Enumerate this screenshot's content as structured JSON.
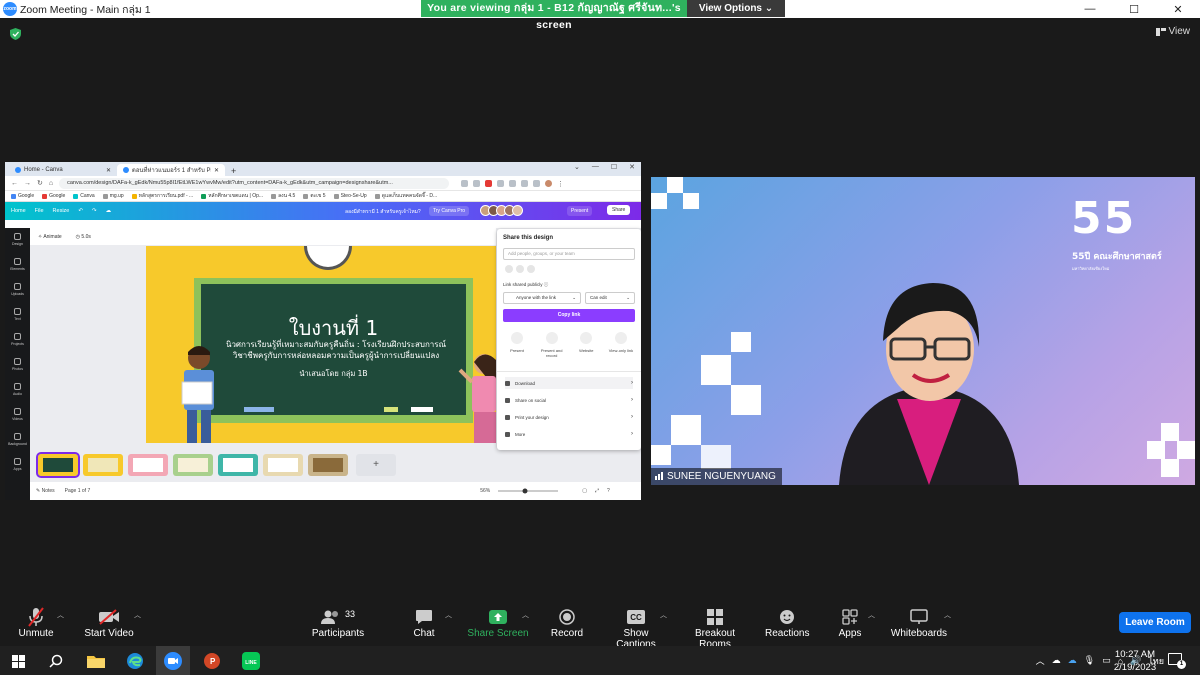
{
  "window": {
    "title": "Zoom Meeting - Main กลุ่ม 1",
    "logo_text": "zoom",
    "controls": [
      "—",
      "☐",
      "✕"
    ]
  },
  "banner": {
    "viewing_text": "You are viewing กลุ่ม 1 - B12 กัญญาณัฐ ศรีจันท...'s screen",
    "view_options": "View Options"
  },
  "view_button": "View",
  "shared_screen": {
    "tabs": [
      {
        "label": "Home - Canva"
      },
      {
        "label": "ตอนที่ห่าวแนมอร์ร 1 สำหรับ Pillow! - Freep..."
      }
    ],
    "url": "canva.com/design/DAFa-k_gEdk/Nmu55p8I1fEtLWE1wYwvMw/edit?utm_content=DAFa-k_gEdk&utm_campaign=designshare&utm...",
    "bookmarks": [
      "Google",
      "Google",
      "Canva",
      "mg.up",
      "หลักสูตรการเรียน.pdf - ...",
      "หลักศึกษาเขตแดน | Op...",
      "ลงน 4.5",
      "ตะเข 5",
      "Steo-Se-Up",
      "ดูแลเก็บแทคคนจัดจี๊ - D..."
    ],
    "canva": {
      "home": "Home",
      "file": "File",
      "resize": "Resize",
      "doc_title": "ลองมีสำหรามี 1 สำหรับครูเจ้าไหม?",
      "try_pro": "Try Canva Pro",
      "present": "Present",
      "share": "Share",
      "animate": "Animate",
      "duration": "5.0s",
      "sidebar": [
        "Design",
        "Elements",
        "Uploads",
        "Text",
        "Projects",
        "Photos",
        "Audio",
        "Videos",
        "Background",
        "Apps"
      ],
      "notes": "Notes",
      "page": "Page 1 of 7",
      "zoom": "56%",
      "slide": {
        "title": "ใบงานที่ 1",
        "subtitle_line1": "นิวศการเรียนรู้ที่เหมาะสมกับครูคืนถิ่น : โรงเรียนฝึกประสบการณ์",
        "subtitle_line2": "วิชาชีพครูกับการหล่อหลอมความเป็นครูผู้นำการเปลี่ยนแปลง",
        "presented_by": "นำเสนอโดย กลุ่ม 1B"
      },
      "share_panel": {
        "title": "Share this design",
        "input_placeholder": "Add people, groups, or your team",
        "link_label": "Link shared publicly ⓘ",
        "access": "Anyone with the link",
        "permission": "Can edit",
        "copy_link": "Copy link",
        "options": [
          {
            "label": "Present",
            "sub": ""
          },
          {
            "label": "Present and",
            "sub": "record"
          },
          {
            "label": "Website",
            "sub": ""
          },
          {
            "label": "View-only link",
            "sub": ""
          }
        ],
        "rows": [
          "Download",
          "Share on social",
          "Print your design",
          "More"
        ]
      }
    }
  },
  "video": {
    "participant_name": "SUNEE NGUENYUANG",
    "logo_text": "55",
    "logo_number": "55",
    "logo_sub": "ปี คณะศึกษาศาสตร์",
    "logo_sub_small": "มหาวิทยาลัยเชียงใหม่"
  },
  "toolbar": {
    "unmute": "Unmute",
    "start_video": "Start Video",
    "participants": "Participants",
    "participants_count": "33",
    "chat": "Chat",
    "share_screen": "Share Screen",
    "record": "Record",
    "show_captions": "Show Captions",
    "breakout_rooms": "Breakout Rooms",
    "reactions": "Reactions",
    "apps": "Apps",
    "whiteboards": "Whiteboards",
    "leave_room": "Leave Room"
  },
  "taskbar": {
    "language": "ไทย",
    "time": "10:27 AM",
    "date": "2/19/2023",
    "notification_count": "1"
  },
  "colors": {
    "share_green": "#2fb15e",
    "leave_blue": "#0e72ed",
    "canva_purple": "#8b3dff"
  }
}
